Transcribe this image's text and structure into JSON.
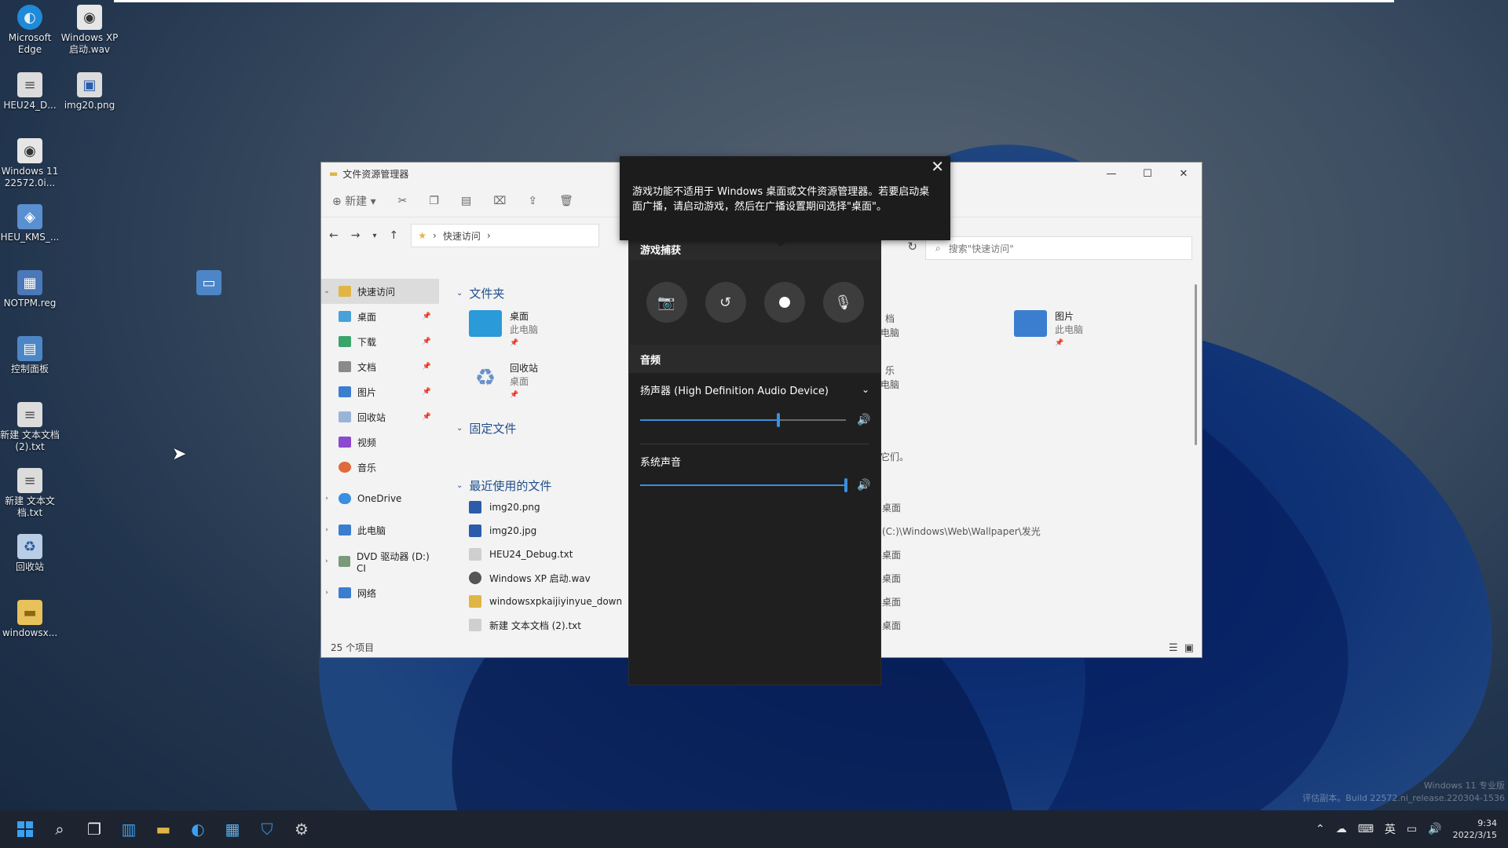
{
  "colors": {
    "accent": "#3a8fe0",
    "panel_bg": "#1f1f1f",
    "taskbar_bg": "#1d2430"
  },
  "desktop_icons": [
    {
      "label": "Microsoft Edge",
      "icon": "edge-icon"
    },
    {
      "label": "Windows XP 启动.wav",
      "icon": "audio-file-icon"
    },
    {
      "label": "HEU24_D...",
      "icon": "text-file-icon"
    },
    {
      "label": "img20.png",
      "icon": "image-file-icon"
    },
    {
      "label": "Windows 11 22572.0i...",
      "icon": "audio-file-icon"
    },
    {
      "label": "HEU_KMS_...",
      "icon": "app-icon"
    },
    {
      "label": "NOTPM.reg",
      "icon": "registry-file-icon"
    },
    {
      "label": "控制面板",
      "icon": "control-panel-icon"
    },
    {
      "label": "新建 文本文档 (2).txt",
      "icon": "text-file-icon"
    },
    {
      "label": "新建 文本文档.txt",
      "icon": "text-file-icon"
    },
    {
      "label": "回收站",
      "icon": "recycle-bin-icon"
    },
    {
      "label": "windowsx...",
      "icon": "folder-icon"
    }
  ],
  "explorer": {
    "title": "文件资源管理器",
    "toolbar": {
      "new_label": "新建"
    },
    "breadcrumb": "快速访问",
    "search_placeholder": "搜索\"快速访问\"",
    "nav": [
      {
        "label": "快速访问",
        "pinned": false
      },
      {
        "label": "桌面",
        "pinned": true
      },
      {
        "label": "下载",
        "pinned": true
      },
      {
        "label": "文档",
        "pinned": true
      },
      {
        "label": "图片",
        "pinned": true
      },
      {
        "label": "回收站",
        "pinned": true
      },
      {
        "label": "视频",
        "pinned": false
      },
      {
        "label": "音乐",
        "pinned": false
      },
      {
        "label": "OneDrive",
        "pinned": false
      },
      {
        "label": "此电脑",
        "pinned": false
      },
      {
        "label": "DVD 驱动器 (D:) CI",
        "pinned": false
      },
      {
        "label": "网络",
        "pinned": false
      }
    ],
    "sections": {
      "folders": "文件夹",
      "pinned_files": "固定文件",
      "recent_files": "最近使用的文件"
    },
    "folder_tiles": [
      {
        "name": "桌面",
        "sub": "此电脑"
      },
      {
        "name": "回收站",
        "sub": "桌面"
      },
      {
        "name": "图片",
        "sub": "此电脑"
      }
    ],
    "right_fragments": [
      "档",
      "电脑",
      "乐",
      "电脑",
      "它们。",
      "桌面",
      "(C:)\\Windows\\Web\\Wallpaper\\发光",
      "桌面",
      "桌面",
      "桌面",
      "桌面"
    ],
    "recent": [
      "img20.png",
      "img20.jpg",
      "HEU24_Debug.txt",
      "Windows XP 启动.wav",
      "windowsxpkaijiyinyue_down",
      "新建 文本文档 (2).txt"
    ],
    "status": "25 个项目"
  },
  "tooltip": {
    "text": "游戏功能不适用于 Windows 桌面或文件资源管理器。若要启动桌面广播，请启动游戏，然后在广播设置期间选择\"桌面\"。"
  },
  "gamebar": {
    "capture_header": "游戏捕获",
    "audio_header": "音频",
    "device": "扬声器 (High Definition Audio Device)",
    "device_volume": 0.67,
    "system_label": "系统声音",
    "system_volume": 1.0
  },
  "taskbar": {
    "apps": [
      "start-icon",
      "search-icon",
      "task-view-icon",
      "widgets-icon",
      "file-explorer-icon",
      "edge-icon",
      "store-icon",
      "defender-icon",
      "settings-icon"
    ],
    "ime": "英",
    "time": "9:34",
    "date": "2022/3/15"
  },
  "watermark": {
    "line1": "Windows 11 专业版",
    "line2": "评估副本。Build 22572.ni_release.220304-1536"
  }
}
